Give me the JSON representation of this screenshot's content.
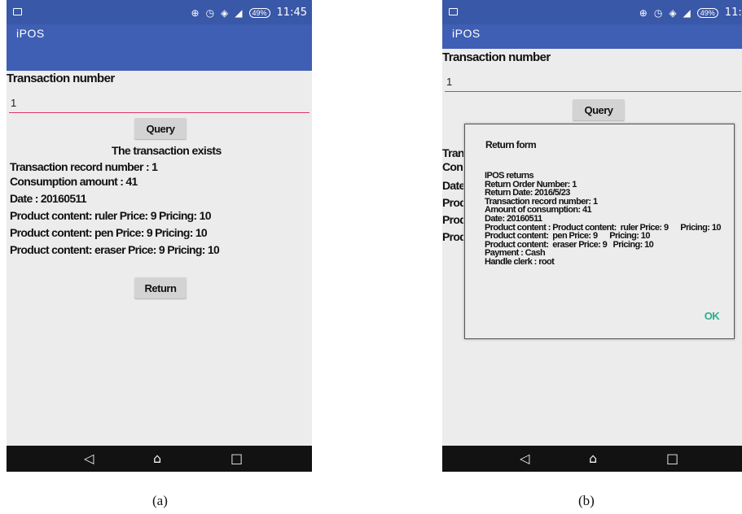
{
  "colors": {
    "statusbar": "#3a58a8",
    "appbar": "#3f5fb5",
    "input_underline": "#e0386a",
    "ok_button": "#2dad8e",
    "navbar": "#121212"
  },
  "screen_a": {
    "status": {
      "battery": "49%",
      "time": "11:45",
      "icons": [
        "notification-icon",
        "vibrate-icon",
        "alarm-icon",
        "wifi-icon",
        "signal-icon"
      ]
    },
    "app_title": "iPOS",
    "txn_label": "Transaction number",
    "txn_value": "1",
    "query_label": "Query",
    "exists_msg": "The transaction exists",
    "info_lines": [
      "Transaction record number : 1",
      "Consumption amount : 41",
      "Date : 20160511",
      "Product content:  ruler Price: 9    Pricing: 10",
      "Product content:  pen Price: 9      Pricing: 10",
      "Product content:  eraser Price: 9  Pricing: 10"
    ],
    "return_label": "Return",
    "nav": {
      "back": "◁",
      "home": "⌂",
      "recent": "□"
    },
    "caption": "(a)"
  },
  "screen_b": {
    "status": {
      "battery": "49%",
      "time": "11:4",
      "icons": [
        "notification-icon",
        "vibrate-icon",
        "alarm-icon",
        "wifi-icon",
        "signal-icon"
      ]
    },
    "app_title": "iPOS",
    "txn_label": "Transaction number",
    "txn_value": "1",
    "query_label": "Query",
    "bg_partials": [
      "Tran",
      "Con",
      "Date",
      "Produ",
      "Produ",
      "Produ"
    ],
    "dialog": {
      "title": "Return form",
      "lines": [
        "IPOS returns",
        "Return Order Number: 1",
        "Return Date: 2016/5/23",
        "Transaction record number: 1",
        "Amount of consumption: 41",
        "Date: 20160511",
        "Product content : Product content:  ruler Price: 9      Pricing: 10",
        "Product content:  pen Price: 9      Pricing: 10",
        "Product content:  eraser Price: 9   Pricing: 10",
        "Payment : Cash",
        "Handle clerk : root"
      ],
      "ok_label": "OK"
    },
    "nav": {
      "back": "◁",
      "home": "⌂",
      "recent": "□"
    },
    "caption": "(b)"
  }
}
